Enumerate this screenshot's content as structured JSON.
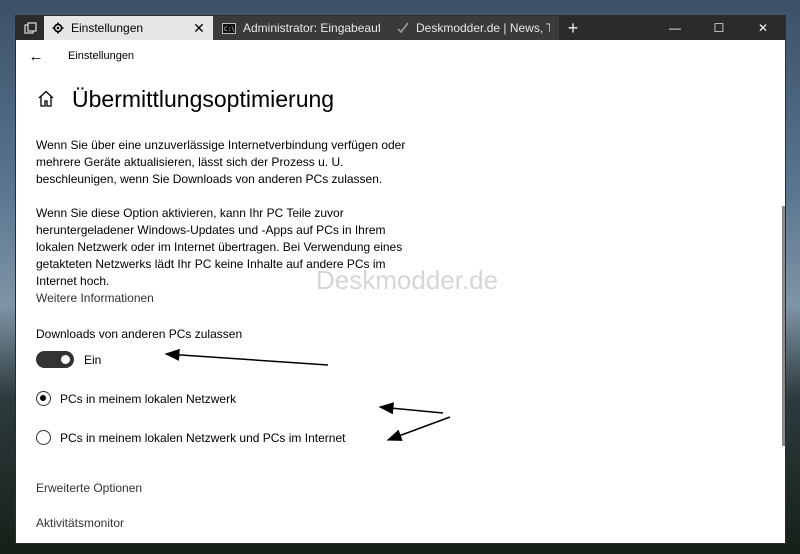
{
  "tabs": [
    {
      "label": "Einstellungen",
      "icon": "gear-icon",
      "active": true
    },
    {
      "label": "Administrator: Eingabeaufforderung",
      "icon": "cmd-icon",
      "active": false
    },
    {
      "label": "Deskmodder.de | News, Tipps",
      "icon": "web-icon",
      "active": false
    }
  ],
  "tab_close_glyph": "✕",
  "new_tab_glyph": "+",
  "window_controls": {
    "minimize": "—",
    "maximize": "☐",
    "close": "✕"
  },
  "header": {
    "back_glyph": "←",
    "app_title": "Einstellungen"
  },
  "page": {
    "title": "Übermittlungsoptimierung",
    "para1": "Wenn Sie über eine unzuverlässige Internetverbindung verfügen oder mehrere Geräte aktualisieren, lässt sich der Prozess u. U. beschleunigen, wenn Sie Downloads von anderen PCs zulassen.",
    "para2": "Wenn Sie diese Option aktivieren, kann Ihr PC Teile zuvor heruntergeladener Windows-Updates und -Apps auf PCs in Ihrem lokalen Netzwerk oder im Internet übertragen. Bei Verwendung eines getakteten Netzwerks lädt Ihr PC keine Inhalte auf andere PCs im Internet hoch.",
    "more_info": "Weitere Informationen",
    "allow_label": "Downloads von anderen PCs zulassen",
    "toggle_state": "Ein",
    "toggle_on": true,
    "options": [
      {
        "label": "PCs in meinem lokalen Netzwerk",
        "checked": true
      },
      {
        "label": "PCs in meinem lokalen Netzwerk und PCs im Internet",
        "checked": false
      }
    ],
    "advanced": "Erweiterte Optionen",
    "activity": "Aktivitätsmonitor"
  },
  "watermark": "Deskmodder.de",
  "colors": {
    "accent_dark": "#333333",
    "tabbar": "#2b2b2b"
  }
}
